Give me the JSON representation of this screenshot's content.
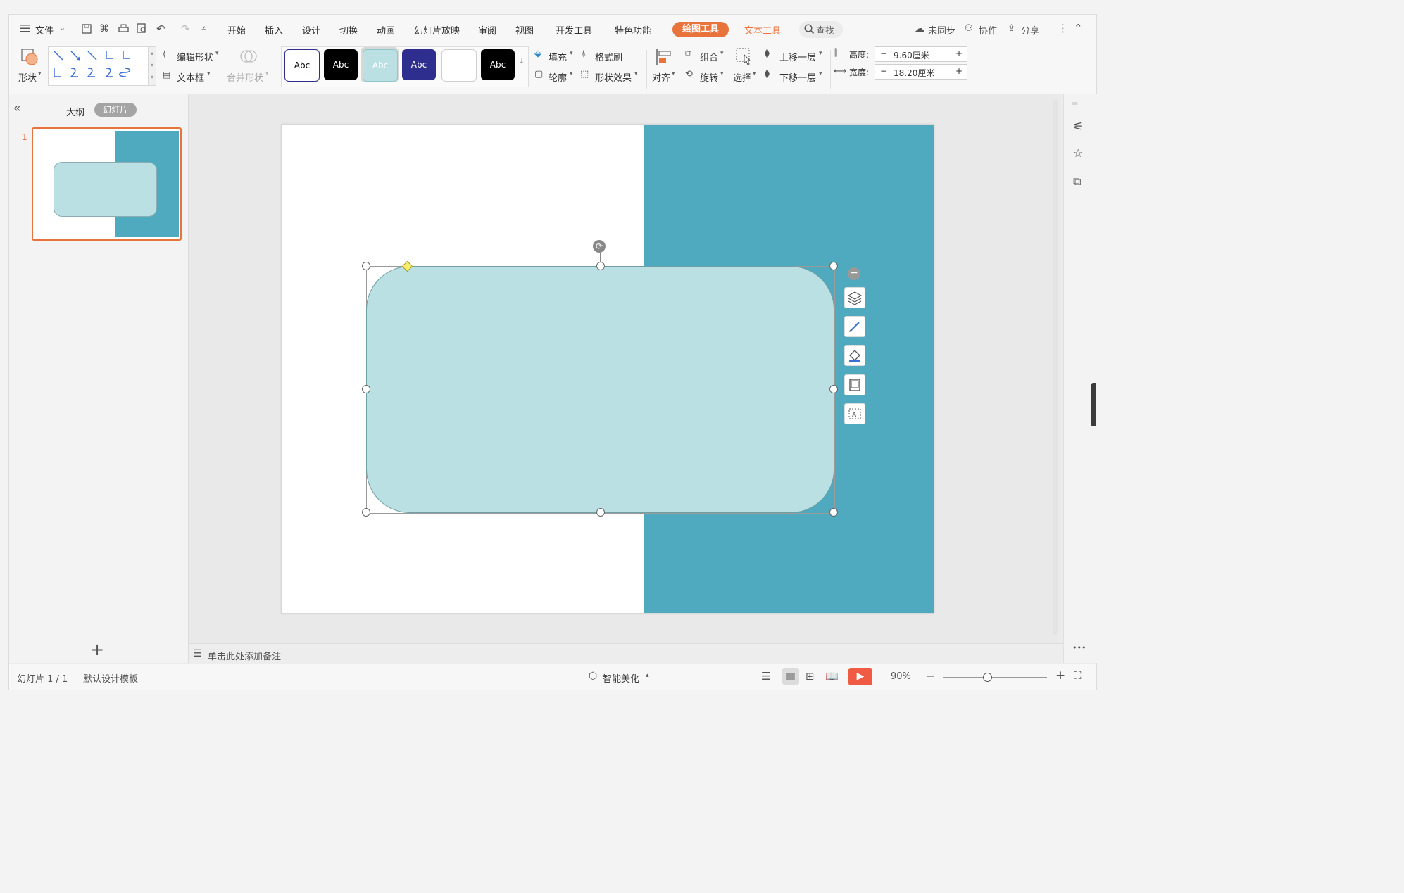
{
  "menubar": {
    "file_menu": "文件",
    "tabs": [
      "开始",
      "插入",
      "设计",
      "切换",
      "动画",
      "幻灯片放映",
      "审阅",
      "视图",
      "开发工具",
      "特色功能"
    ],
    "active_tab": "绘图工具",
    "text_tools_tab": "文本工具",
    "search": "查找",
    "sync": "未同步",
    "collab": "协作",
    "share": "分享"
  },
  "ribbon": {
    "shape": "形状",
    "edit_shape": "编辑形状",
    "text_box": "文本框",
    "merge_shape": "合并形状",
    "style_sample": "Abc",
    "fill": "填充",
    "format_painter": "格式刷",
    "outline": "轮廓",
    "shape_effect": "形状效果",
    "align": "对齐",
    "group": "组合",
    "rotate": "旋转",
    "select": "选择",
    "bring_forward": "上移一层",
    "send_backward": "下移一层",
    "height_label": "高度:",
    "height_value": "9.60厘米",
    "width_label": "宽度:",
    "width_value": "18.20厘米",
    "minus": "−",
    "plus": "+"
  },
  "left_panel": {
    "collapse": "«",
    "outline_tab": "大纲",
    "slides_tab": "幻灯片",
    "slide_number": "1",
    "add_slide": "+"
  },
  "notes": {
    "placeholder": "单击此处添加备注"
  },
  "status": {
    "slide_info": "幻灯片 1 / 1",
    "template": "默认设计模板",
    "smart": "智能美化",
    "zoom": "90%",
    "more": "•••"
  },
  "colors": {
    "teal": "#4faac0",
    "light_teal": "#bae0e3",
    "accent_orange": "#e8743b",
    "dark_blue_style": "#2e2e8e"
  },
  "icons": [
    "menu-icon",
    "save-icon",
    "print-icon",
    "undo-icon",
    "redo-icon",
    "search-icon",
    "cloud-icon",
    "user-icon",
    "share-icon",
    "layers-icon",
    "brush-icon",
    "fill-icon",
    "frame-icon",
    "text-frame-icon"
  ]
}
